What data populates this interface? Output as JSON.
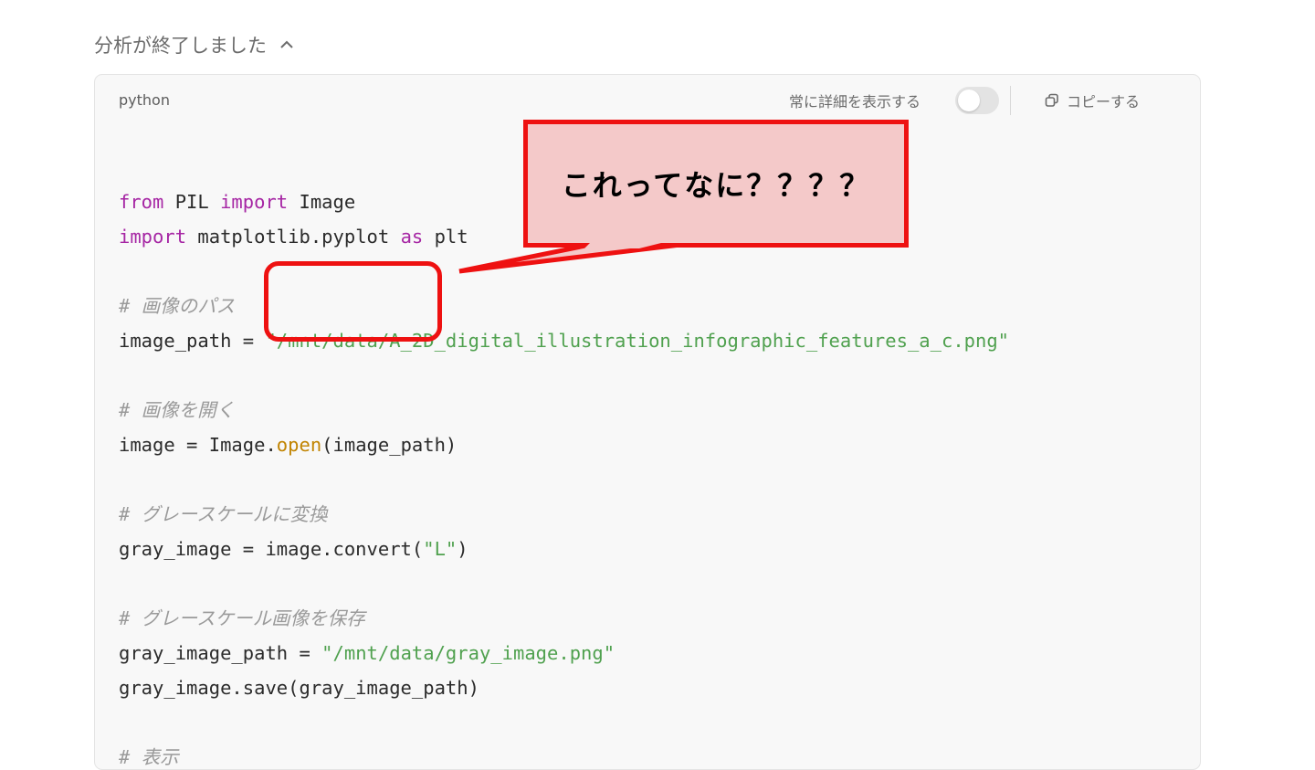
{
  "header": {
    "title": "分析が終了しました"
  },
  "code_block": {
    "language": "python",
    "show_details_label": "常に詳細を表示する",
    "show_details_on": false,
    "copy_label": "コピーする",
    "lines": [
      [],
      [
        {
          "t": "from",
          "c": "kw"
        },
        {
          "t": " PIL "
        },
        {
          "t": "import",
          "c": "kw"
        },
        {
          "t": " Image"
        }
      ],
      [
        {
          "t": "import",
          "c": "kw"
        },
        {
          "t": " matplotlib.pyplot "
        },
        {
          "t": "as",
          "c": "kw"
        },
        {
          "t": " plt"
        }
      ],
      [],
      [
        {
          "t": "# 画像のパス",
          "c": "cmt"
        }
      ],
      [
        {
          "t": "image_path = "
        },
        {
          "t": "\"/mnt/data/A_2D_digital_illustration_infographic_features_a_c.png\"",
          "c": "str"
        }
      ],
      [],
      [
        {
          "t": "# 画像を開く",
          "c": "cmt"
        }
      ],
      [
        {
          "t": "image = Image."
        },
        {
          "t": "open",
          "c": "fn"
        },
        {
          "t": "(image_path)"
        }
      ],
      [],
      [
        {
          "t": "# グレースケールに変換",
          "c": "cmt"
        }
      ],
      [
        {
          "t": "gray_image = image.convert("
        },
        {
          "t": "\"L\"",
          "c": "str"
        },
        {
          "t": ")"
        }
      ],
      [],
      [
        {
          "t": "# グレースケール画像を保存",
          "c": "cmt"
        }
      ],
      [
        {
          "t": "gray_image_path = "
        },
        {
          "t": "\"/mnt/data/gray_image.png\"",
          "c": "str"
        }
      ],
      [
        {
          "t": "gray_image.save(gray_image_path)"
        }
      ],
      [],
      [
        {
          "t": "# 表示",
          "c": "cmt"
        }
      ]
    ]
  },
  "annotation": {
    "text": "これってなに？？？？",
    "color": "#ee1111",
    "fill": "#f4c9c9"
  }
}
